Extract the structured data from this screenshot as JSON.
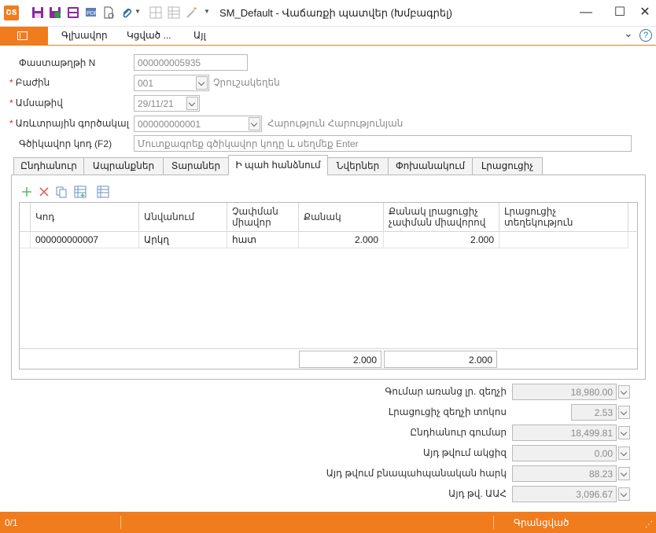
{
  "app": {
    "title": "SM_Default - Վաճառքի պատվեր (Խմբագրել)",
    "logo_text": "ՇՏ",
    "accent_color": "#f07c1e"
  },
  "toolbar": {
    "icons": [
      "save-icon",
      "save-close-icon",
      "save-as-icon",
      "print-preview-icon",
      "document-icon",
      "attach-icon",
      "grid-icon",
      "grid-alt-icon",
      "wand-icon",
      "customize-icon"
    ]
  },
  "window_controls": {
    "minimize": "—",
    "maximize": "☐",
    "close": "✕"
  },
  "ribbon": {
    "tabs": [
      "Գլխավոր",
      "Կցված ...",
      "Այլ"
    ],
    "collapse": "⌄",
    "help": "?"
  },
  "form": {
    "doc_number": {
      "label": "Փաստաթղթի N",
      "value": "000000005935"
    },
    "division": {
      "label": "Բաժին",
      "value": "001",
      "hint": "Չրուշակեղեն"
    },
    "date": {
      "label": "Ամսաթիվ",
      "value": "29/11/21"
    },
    "partner": {
      "label": "Առևտրային գործակալ",
      "value": "000000000001",
      "hint": "Հարություն Հարությունյան"
    },
    "barcode": {
      "label": "Գծիկավոր կոդ (F2)",
      "placeholder": "Մուտքագրեք գծիկավոր կոդը և սեղմեք Enter"
    }
  },
  "tabs": [
    "Ընդհանուր",
    "Ապրանքներ",
    "Տարաներ",
    "Ի պահ հանձնում",
    "Նվերներ",
    "Փոխանակում",
    "Լրացուցիչ"
  ],
  "active_tab": "Ի պահ հանձնում",
  "grid": {
    "columns": [
      "Կոդ",
      "Անվանում",
      "Չափման միավոր",
      "Քանակ",
      "Քանակ լրացուցիչ չափման միավորով",
      "Լրացուցիչ տեղեկություն"
    ],
    "rows": [
      {
        "code": "000000000007",
        "name": "Արկղ",
        "unit": "հատ",
        "qty": "2.000",
        "qty_extra": "2.000",
        "info": ""
      }
    ],
    "totals": {
      "qty": "2.000",
      "qty_extra": "2.000"
    }
  },
  "summary": [
    {
      "label": "Գումար առանց լր. զեղչի",
      "value": "18,980.00"
    },
    {
      "label": "Լրացուցիչ զեղչի տոկոս",
      "value": "2.53"
    },
    {
      "label": "Ընդհանուր գումար",
      "value": "18,499.81"
    },
    {
      "label": "Այդ թվում ակցիզ",
      "value": "0.00"
    },
    {
      "label": "Այդ թվում բնապահպանական հարկ",
      "value": "88.23"
    },
    {
      "label": "Այդ թվ. ԱԱՀ",
      "value": "3,096.67"
    }
  ],
  "status": {
    "record": "0/1",
    "state": "Գրանցված"
  }
}
